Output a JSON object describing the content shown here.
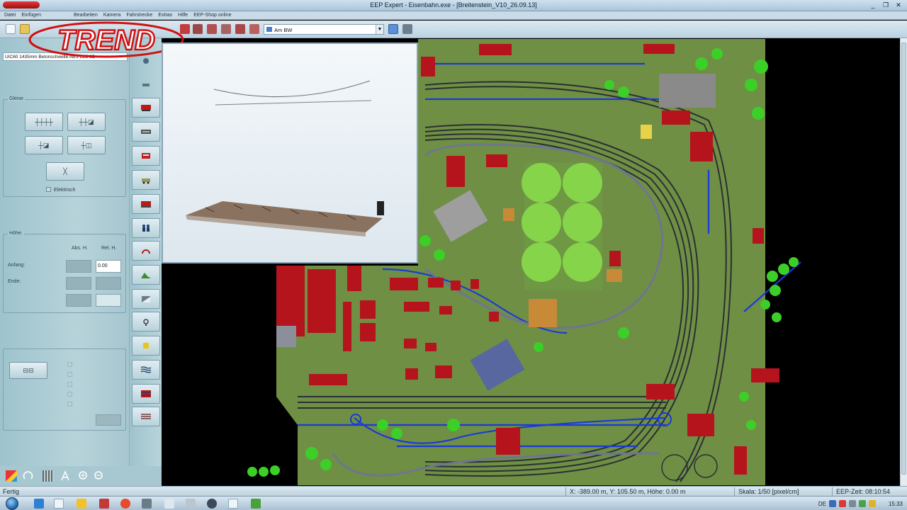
{
  "window": {
    "title": "EEP Expert - Eisenbahn.exe - [Breitenstein_V10_26.09.13]",
    "controls": [
      "_",
      "❐",
      "✕"
    ]
  },
  "menu": {
    "items": [
      "Datei",
      "Einfügen",
      "Bearbeiten",
      "Kamera",
      "Fahrstrecke",
      "Extras",
      "Hilfe",
      "EEP-Shop online"
    ]
  },
  "toolbar": {
    "layer_select": "Am BW",
    "icons": [
      "new-icon",
      "open-icon",
      "save-icon",
      "track-tool-icon",
      "signal-icon",
      "switch-icon",
      "crane-icon",
      "selector-icon"
    ]
  },
  "logo": {
    "text": "TREND",
    "color": "#d01010"
  },
  "left_panel": {
    "track_name": "UIC60 1435mm Betonschwelle ABS LZB 3D",
    "tracks_group": {
      "title": "Gleise",
      "elektrisch_label": "Elektrisch"
    },
    "height_group": {
      "title": "Höhe:",
      "abs_label": "Abs. H.",
      "rel_label": "Rel. H.",
      "anfang_label": "Anfang:",
      "ende_label": "Ende:",
      "rel_anfang_value": "0.00"
    }
  },
  "left_strip": {
    "icons": [
      "track-layout-icon",
      "ballast-icon",
      "rail-vehicle-icon",
      "road-icon",
      "tram-icon",
      "vehicle-icon",
      "people-icon",
      "signal-icon",
      "landscape-icon",
      "structure-icon",
      "camera-icon",
      "goods-icon",
      "water-icon",
      "flag-icon",
      "bridge-icon"
    ]
  },
  "bottom_tools": {
    "icons": [
      "cube-icon",
      "rotate-icon",
      "grid-icon",
      "text-icon",
      "zoom-in-icon",
      "zoom-out-icon"
    ]
  },
  "statusbar": {
    "ready": "Fertig",
    "position": "X: -389.00 m, Y: 105.50 m, Höhe: 0.00 m",
    "scale": "Skala: 1/50 [pixel/cm]",
    "eep_time": "EEP-Zeit: 08:10:54"
  },
  "taskbar": {
    "lang": "DE",
    "clock": "15:33",
    "apps": [
      "explorer-icon",
      "ie-icon",
      "folder-icon",
      "media-icon",
      "browser-icon",
      "app-icon",
      "doc-icon",
      "tool-icon",
      "chrome-icon",
      "eep-icon",
      "game-icon"
    ]
  },
  "colors": {
    "terrain": "#6f8f45",
    "grass": "#5aa62f",
    "building": "#b5141c",
    "track_blue": "#1a3ad8",
    "track_dark": "#2b2f33",
    "ui_panel": "#a9c9d2"
  }
}
